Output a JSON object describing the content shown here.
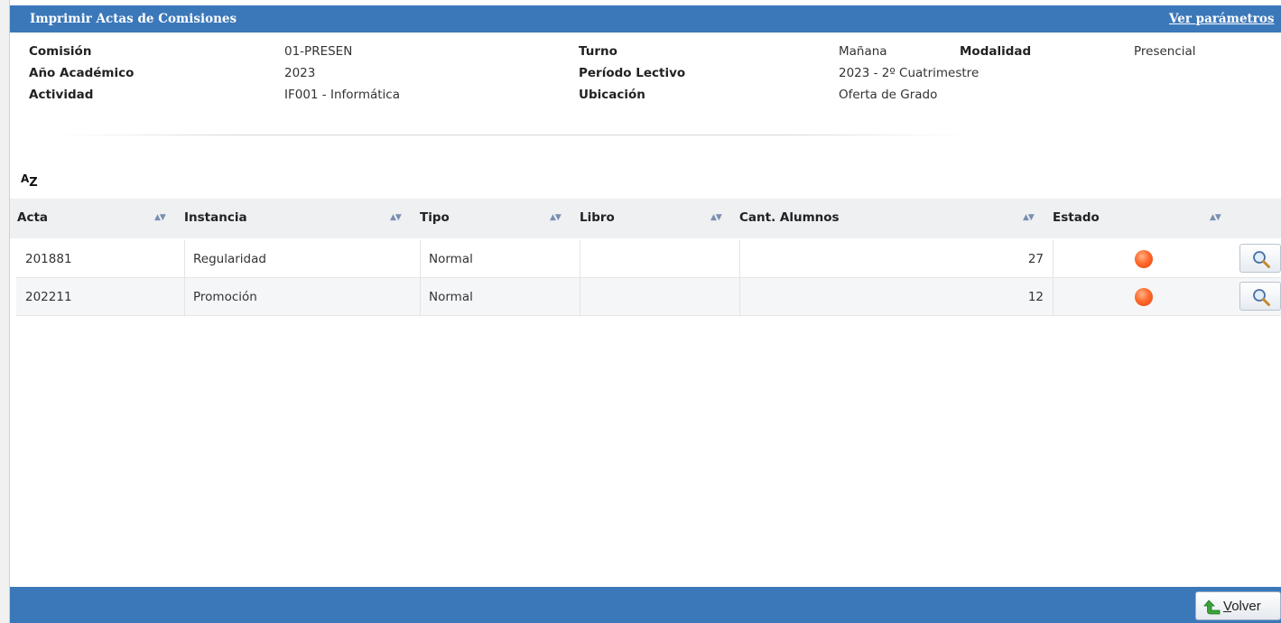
{
  "header": {
    "title": "Imprimir Actas de Comisiones",
    "params_link": "Ver parámetros"
  },
  "info": {
    "comision_label": "Comisión",
    "comision_value": "01-PRESEN",
    "anio_label": "Año Académico",
    "anio_value": "2023",
    "actividad_label": "Actividad",
    "actividad_value": "IF001 - Informática",
    "turno_label": "Turno",
    "turno_value": "Mañana",
    "periodo_label": "Período Lectivo",
    "periodo_value": "2023 - 2º Cuatrimestre",
    "ubicacion_label": "Ubicación",
    "ubicacion_value": "Oferta de Grado",
    "modalidad_label": "Modalidad",
    "modalidad_value": "Presencial"
  },
  "sort_icon": {
    "a": "A",
    "z": "Z"
  },
  "table": {
    "columns": [
      "Acta",
      "Instancia",
      "Tipo",
      "Libro",
      "Cant. Alumnos",
      "Estado"
    ],
    "rows": [
      {
        "acta": "201881",
        "instancia": "Regularidad",
        "tipo": "Normal",
        "libro": "",
        "cant": "27",
        "estado_color": "#ff5a1f"
      },
      {
        "acta": "202211",
        "instancia": "Promoción",
        "tipo": "Normal",
        "libro": "",
        "cant": "12",
        "estado_color": "#ff5a1f"
      }
    ]
  },
  "footer": {
    "volver_first": "V",
    "volver_rest": "olver"
  },
  "colors": {
    "header_blue": "#3b78b9",
    "status_dot": "#ff5a1f"
  }
}
